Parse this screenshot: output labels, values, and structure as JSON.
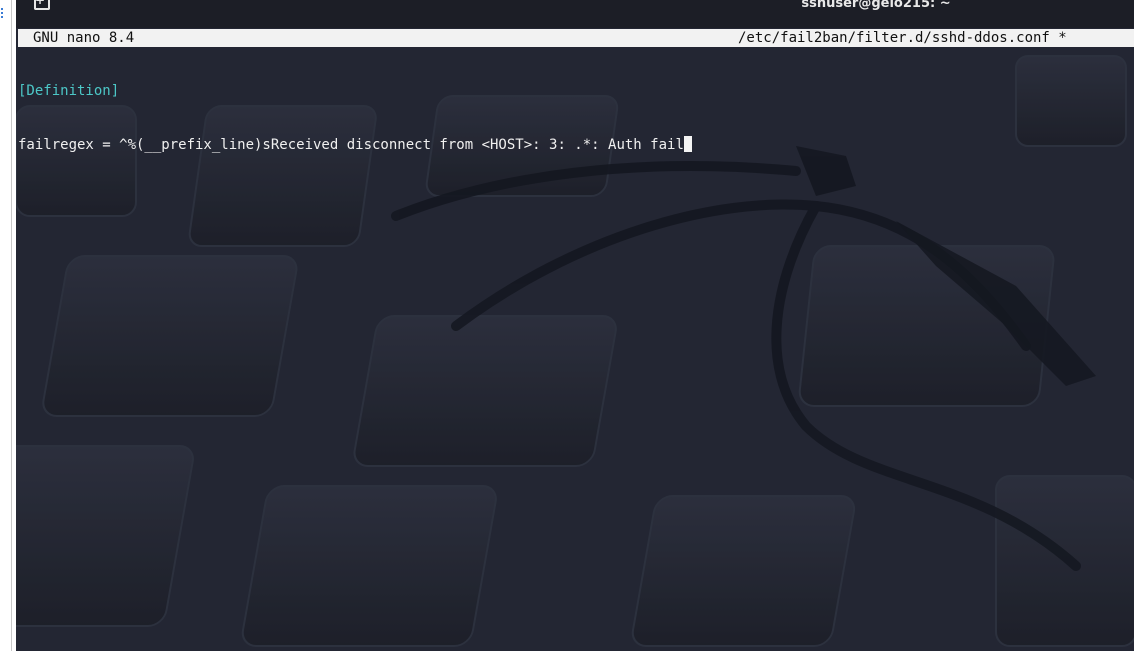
{
  "window": {
    "title": "sshuser@gelo215: ~",
    "icons": {
      "new_tab": "new-tab-icon"
    }
  },
  "nano": {
    "app_version": "GNU nano 8.4",
    "file_path": "/etc/fail2ban/filter.d/sshd-ddos.conf *",
    "lines": [
      {
        "text": "[Definition]",
        "kind": "section"
      },
      {
        "text": "failregex = ^%(__prefix_line)sReceived disconnect from <HOST>: 3: .*: Auth fail",
        "kind": "text"
      }
    ]
  },
  "colors": {
    "terminal_bg": "#232633",
    "section_header": "#4cc7c7",
    "header_bar": "#f2f2f2",
    "text": "#f0f0f0"
  }
}
